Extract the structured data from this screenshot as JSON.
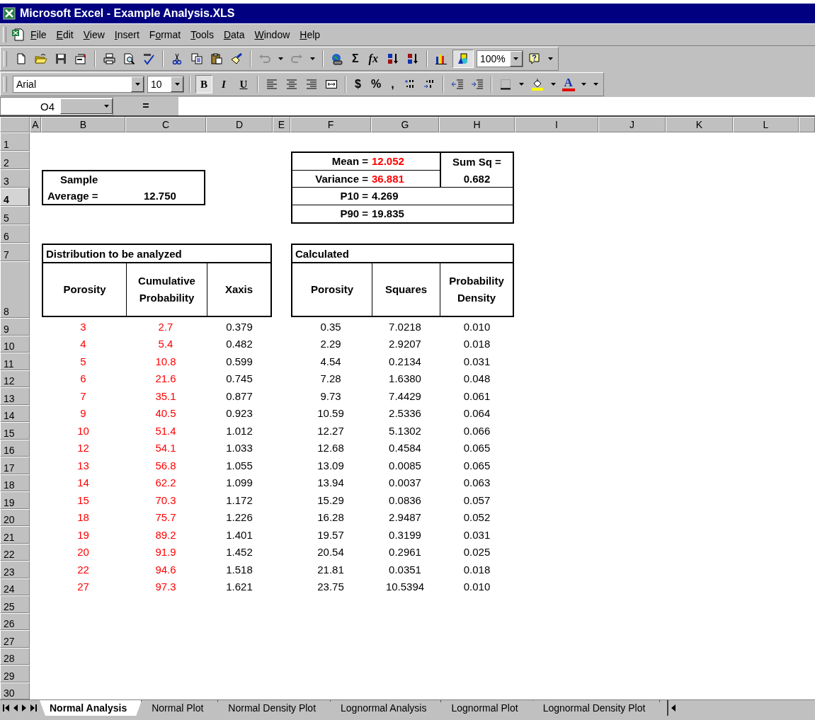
{
  "window": {
    "title": "Microsoft Excel - Example Analysis.XLS"
  },
  "menu": [
    {
      "key": "F",
      "rest": "ile"
    },
    {
      "key": "E",
      "rest": "dit"
    },
    {
      "key": "V",
      "rest": "iew"
    },
    {
      "key": "I",
      "rest": "nsert"
    },
    {
      "pre": "F",
      "key": "o",
      "rest": "rmat"
    },
    {
      "key": "T",
      "rest": "ools"
    },
    {
      "key": "D",
      "rest": "ata"
    },
    {
      "key": "W",
      "rest": "indow"
    },
    {
      "key": "H",
      "rest": "elp"
    }
  ],
  "standard_toolbar": {
    "undo": {
      "disabled": true
    },
    "redo": {
      "disabled": true
    },
    "autosum": "Σ",
    "function": "fx",
    "drawing": {
      "pressed": true
    },
    "zoom": "100%"
  },
  "formatting_toolbar": {
    "font": "Arial",
    "size": "10",
    "bold": {
      "label": "B",
      "pressed": true
    },
    "italic": {
      "label": "I",
      "pressed": false
    },
    "underline": {
      "label": "U",
      "pressed": false
    },
    "currency": "$",
    "percent": "%",
    "comma": ",",
    "font_color": "A"
  },
  "formula_bar": {
    "name_box": "O4",
    "equals": "="
  },
  "sheet": {
    "columns": [
      "A",
      "B",
      "C",
      "D",
      "E",
      "F",
      "G",
      "H",
      "I",
      "J",
      "K",
      "L"
    ],
    "rows": [
      {
        "label": "1",
        "selected": false
      },
      {
        "label": "2",
        "selected": false
      },
      {
        "label": "3",
        "selected": false
      },
      {
        "label": "4",
        "selected": true
      },
      {
        "label": "5",
        "selected": false
      },
      {
        "label": "6",
        "selected": false
      },
      {
        "label": "7",
        "selected": false
      },
      {
        "label": "8",
        "selected": false
      },
      {
        "label": "9",
        "selected": false
      },
      {
        "label": "10",
        "selected": false
      },
      {
        "label": "11",
        "selected": false
      },
      {
        "label": "12",
        "selected": false
      },
      {
        "label": "13",
        "selected": false
      },
      {
        "label": "14",
        "selected": false
      },
      {
        "label": "15",
        "selected": false
      },
      {
        "label": "16",
        "selected": false
      },
      {
        "label": "17",
        "selected": false
      },
      {
        "label": "18",
        "selected": false
      },
      {
        "label": "19",
        "selected": false
      },
      {
        "label": "20",
        "selected": false
      },
      {
        "label": "21",
        "selected": false
      },
      {
        "label": "22",
        "selected": false
      },
      {
        "label": "23",
        "selected": false
      },
      {
        "label": "24",
        "selected": false
      },
      {
        "label": "25",
        "selected": false
      },
      {
        "label": "26",
        "selected": false
      },
      {
        "label": "27",
        "selected": false
      },
      {
        "label": "28",
        "selected": false
      },
      {
        "label": "29",
        "selected": false
      },
      {
        "label": "30",
        "selected": false
      }
    ],
    "sample_box": {
      "title": "Sample",
      "label": "Average =",
      "value": "12.750"
    },
    "stats_box": {
      "mean": {
        "label": "Mean =",
        "value": "12.052",
        "kind": "input"
      },
      "variance": {
        "label": "Variance =",
        "value": "36.881",
        "kind": "input"
      },
      "sum_sq": {
        "label": "Sum Sq =",
        "value": "0.682"
      },
      "p10": {
        "label": "P10 =",
        "value": "4.269"
      },
      "p90": {
        "label": "P90 =",
        "value": "19.835"
      }
    },
    "tables": [
      {
        "title": "Distribution to be analyzed",
        "columns": [
          {
            "header": "Porosity",
            "kind": "input"
          },
          {
            "header": "Cumulative Probability",
            "kind": "input"
          },
          {
            "header": "Xaxis",
            "kind": "formula"
          }
        ],
        "rows": [
          [
            "3",
            "2.7",
            "0.379"
          ],
          [
            "4",
            "5.4",
            "0.482"
          ],
          [
            "5",
            "10.8",
            "0.599"
          ],
          [
            "6",
            "21.6",
            "0.745"
          ],
          [
            "7",
            "35.1",
            "0.877"
          ],
          [
            "9",
            "40.5",
            "0.923"
          ],
          [
            "10",
            "51.4",
            "1.012"
          ],
          [
            "12",
            "54.1",
            "1.033"
          ],
          [
            "13",
            "56.8",
            "1.055"
          ],
          [
            "14",
            "62.2",
            "1.099"
          ],
          [
            "15",
            "70.3",
            "1.172"
          ],
          [
            "18",
            "75.7",
            "1.226"
          ],
          [
            "19",
            "89.2",
            "1.401"
          ],
          [
            "20",
            "91.9",
            "1.452"
          ],
          [
            "22",
            "94.6",
            "1.518"
          ],
          [
            "27",
            "97.3",
            "1.621"
          ]
        ]
      },
      {
        "title": "Calculated",
        "columns": [
          {
            "header": "Porosity",
            "kind": "formula"
          },
          {
            "header": "Squares",
            "kind": "formula"
          },
          {
            "header": "Probability Density",
            "kind": "formula"
          }
        ],
        "rows": [
          [
            "0.35",
            "7.0218",
            "0.010"
          ],
          [
            "2.29",
            "2.9207",
            "0.018"
          ],
          [
            "4.54",
            "0.2134",
            "0.031"
          ],
          [
            "7.28",
            "1.6380",
            "0.048"
          ],
          [
            "9.73",
            "7.4429",
            "0.061"
          ],
          [
            "10.59",
            "2.5336",
            "0.064"
          ],
          [
            "12.27",
            "5.1302",
            "0.066"
          ],
          [
            "12.68",
            "0.4584",
            "0.065"
          ],
          [
            "13.09",
            "0.0085",
            "0.065"
          ],
          [
            "13.94",
            "0.0037",
            "0.063"
          ],
          [
            "15.29",
            "0.0836",
            "0.057"
          ],
          [
            "16.28",
            "2.9487",
            "0.052"
          ],
          [
            "19.57",
            "0.3199",
            "0.031"
          ],
          [
            "20.54",
            "0.2961",
            "0.025"
          ],
          [
            "21.81",
            "0.0351",
            "0.018"
          ],
          [
            "23.75",
            "10.5394",
            "0.010"
          ]
        ]
      }
    ]
  },
  "sheet_tabs": [
    {
      "label": "Normal Analysis",
      "selected": true
    },
    {
      "label": "Normal Plot",
      "selected": false
    },
    {
      "label": "Normal Density Plot",
      "selected": false
    },
    {
      "label": "Lognormal Analysis",
      "selected": false
    },
    {
      "label": "Lognormal Plot",
      "selected": false
    },
    {
      "label": "Lognormal Density Plot",
      "selected": false
    }
  ]
}
